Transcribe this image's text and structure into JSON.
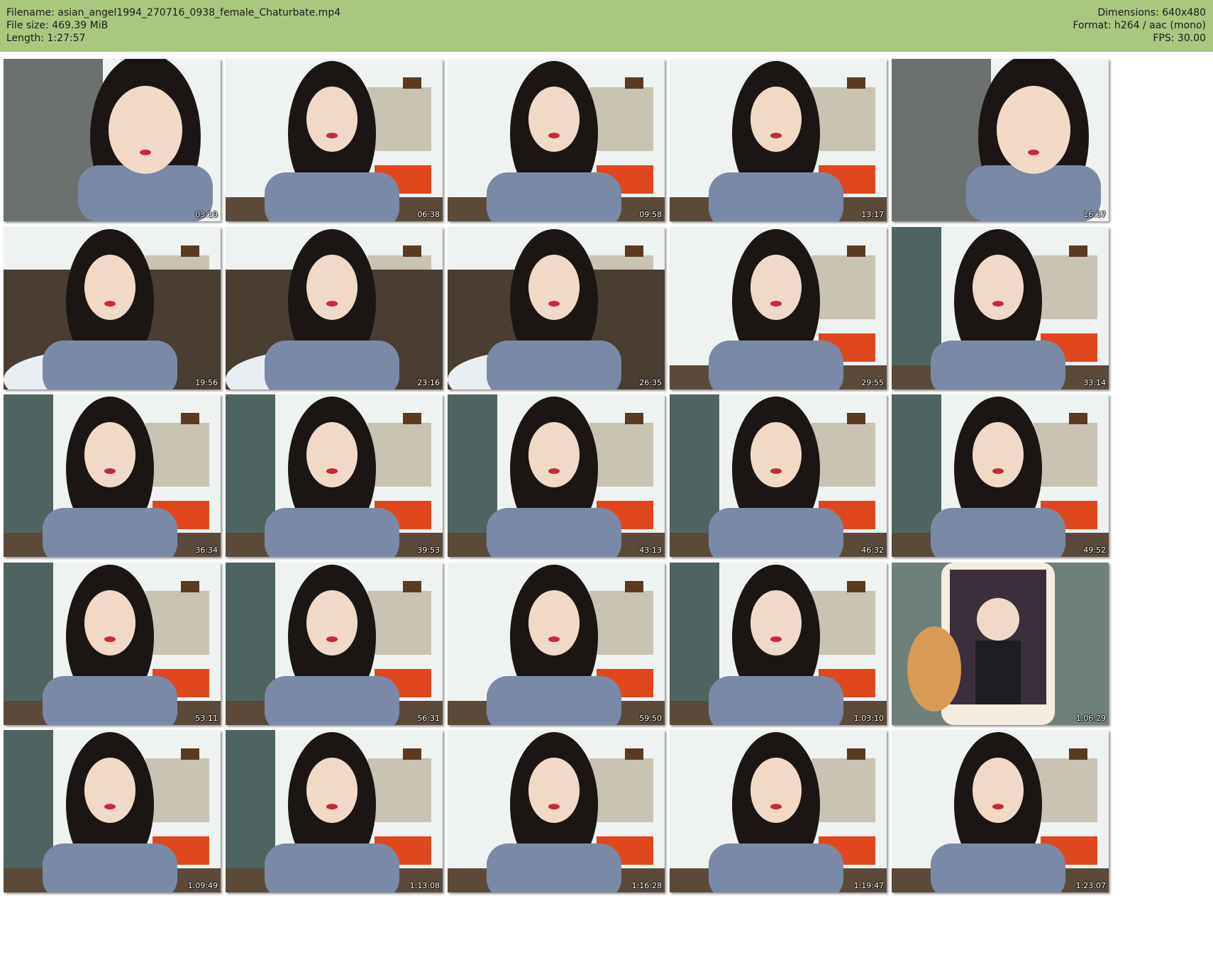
{
  "header": {
    "filename_line": "Filename: asian_angel1994_270716_0938_female_Chaturbate.mp4",
    "filesize_line": "File size: 469.39 MiB",
    "length_line": "Length: 1:27:57",
    "dimensions_line": "Dimensions: 640x480",
    "format_line": "Format: h264 / aac (mono)",
    "fps_line": "FPS: 30.00"
  },
  "colors": {
    "header_bg": "#a9c87e",
    "sweater": "#7a8aa6",
    "skin": "#f1d9c8",
    "hair": "#1b1614",
    "wall_white": "#eef2f0",
    "wallpaper": "#4f6460",
    "orange_chairs": "#e0471c"
  },
  "thumbnails": [
    {
      "timestamp": "03:19",
      "scene": "closeup-wallpaper"
    },
    {
      "timestamp": "06:38",
      "scene": "room"
    },
    {
      "timestamp": "09:58",
      "scene": "room-side"
    },
    {
      "timestamp": "13:17",
      "scene": "room-lean"
    },
    {
      "timestamp": "16:37",
      "scene": "closeup-hand"
    },
    {
      "timestamp": "19:56",
      "scene": "couch-hand"
    },
    {
      "timestamp": "23:16",
      "scene": "couch-pillow"
    },
    {
      "timestamp": "26:35",
      "scene": "couch-pillow-smile"
    },
    {
      "timestamp": "29:55",
      "scene": "room-fan"
    },
    {
      "timestamp": "33:14",
      "scene": "wallpaper-smile"
    },
    {
      "timestamp": "36:34",
      "scene": "wallpaper-room"
    },
    {
      "timestamp": "39:53",
      "scene": "wallpaper-room-down"
    },
    {
      "timestamp": "43:13",
      "scene": "wallpaper-room-tilt"
    },
    {
      "timestamp": "46:32",
      "scene": "wallpaper-room-smile"
    },
    {
      "timestamp": "49:52",
      "scene": "wallpaper-room-kiss"
    },
    {
      "timestamp": "53:11",
      "scene": "wallpaper-close"
    },
    {
      "timestamp": "56:31",
      "scene": "wallpaper-room-far"
    },
    {
      "timestamp": "59:50",
      "scene": "room-stretch"
    },
    {
      "timestamp": "1:03:10",
      "scene": "wallpaper-talk"
    },
    {
      "timestamp": "1:06:29",
      "scene": "phone-photo"
    },
    {
      "timestamp": "1:09:49",
      "scene": "wallpaper-close-2"
    },
    {
      "timestamp": "1:13:08",
      "scene": "wallpaper-room-2"
    },
    {
      "timestamp": "1:16:28",
      "scene": "room-crop"
    },
    {
      "timestamp": "1:19:47",
      "scene": "room-arm-up"
    },
    {
      "timestamp": "1:23:07",
      "scene": "room-standing"
    }
  ]
}
